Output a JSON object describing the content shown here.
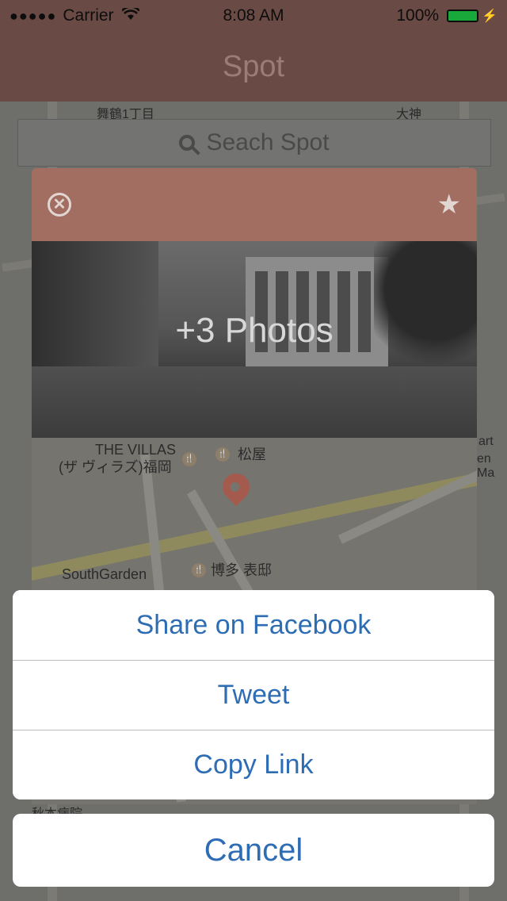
{
  "status_bar": {
    "signal": "●●●●●",
    "carrier": "Carrier",
    "time": "8:08 AM",
    "battery_percent": "100%",
    "battery_level": 1.0
  },
  "nav": {
    "title": "Spot"
  },
  "background_map": {
    "labels": [
      "舞鶴1丁目",
      "大神",
      "秋本病院",
      "art",
      "en Ma"
    ]
  },
  "search": {
    "placeholder": "Seach Spot"
  },
  "card": {
    "close_icon": "close-circle-icon",
    "star_icon": "star-icon",
    "photo_caption": "+3 Photos",
    "map_labels": {
      "the_villas": "THE VILLAS",
      "the_villas_jp": "(ザ ヴィラズ)福岡",
      "matsuya": "松屋",
      "southgarden": "SouthGarden",
      "hakata_omoteyashiki": "博多 表邸"
    }
  },
  "action_sheet": {
    "share_facebook": "Share on Facebook",
    "tweet": "Tweet",
    "copy_link": "Copy Link",
    "cancel": "Cancel"
  },
  "colors": {
    "nav_bar": "#6a4a44",
    "card_header": "#a26e62",
    "action_text": "#2e6db4",
    "pin": "#a55a4e"
  }
}
